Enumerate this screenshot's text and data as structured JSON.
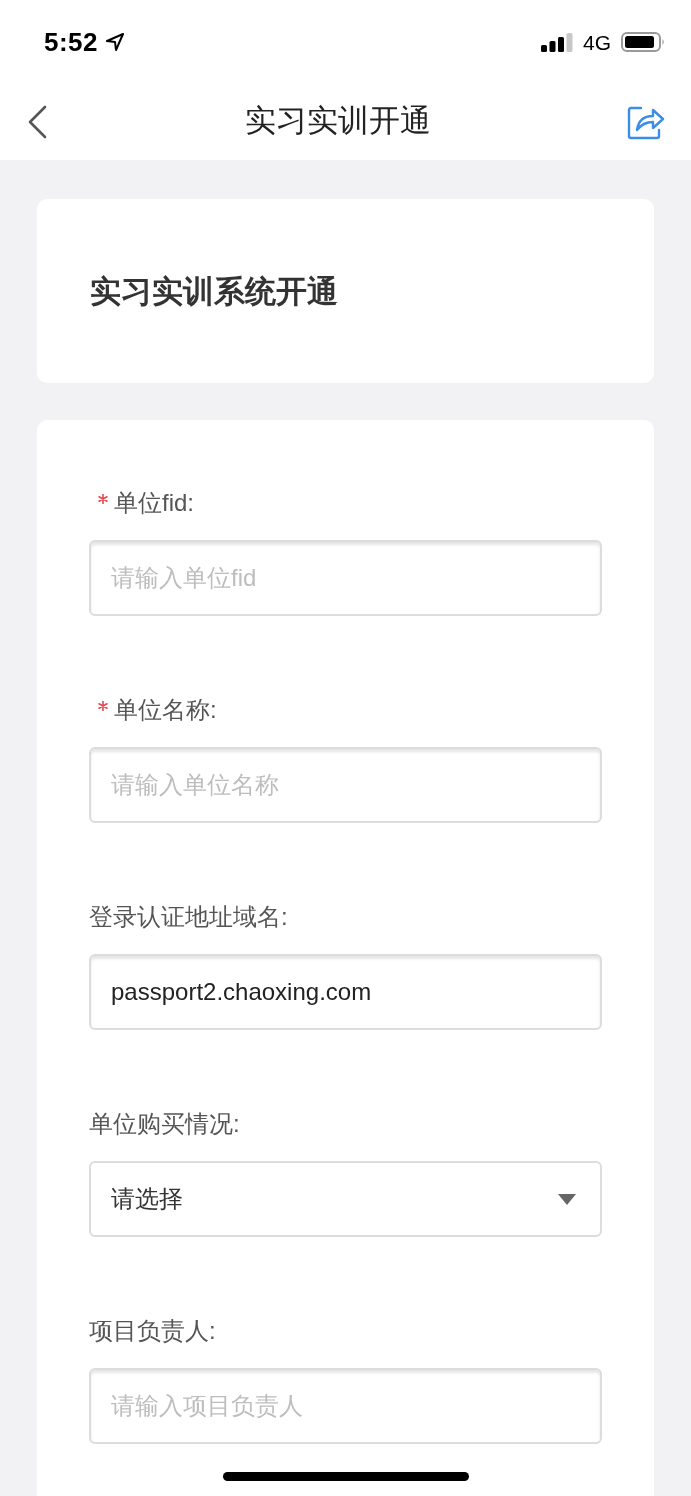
{
  "status_bar": {
    "time": "5:52",
    "network": "4G"
  },
  "nav_bar": {
    "title": "实习实训开通"
  },
  "header_card": {
    "title": "实习实训系统开通"
  },
  "form": {
    "fields": [
      {
        "kind": "input",
        "label": "单位fid:",
        "required": true,
        "placeholder": "请输入单位fid"
      },
      {
        "kind": "input",
        "label": "单位名称:",
        "required": true,
        "placeholder": "请输入单位名称"
      },
      {
        "kind": "input",
        "label": "登录认证地址域名:",
        "required": false,
        "value": "passport2.chaoxing.com"
      },
      {
        "kind": "select",
        "label": "单位购买情况:",
        "required": false,
        "value": "请选择"
      },
      {
        "kind": "input",
        "label": "项目负责人:",
        "required": false,
        "placeholder": "请输入项目负责人"
      }
    ]
  }
}
